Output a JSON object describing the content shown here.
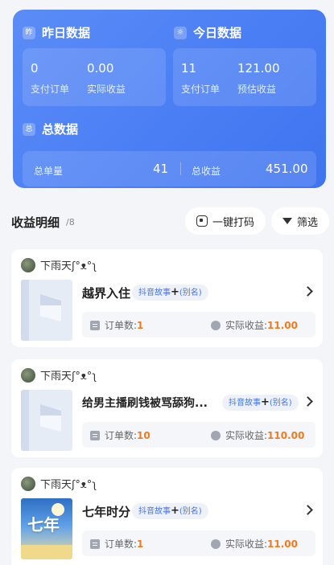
{
  "yesterday": {
    "icon_text": "昨",
    "title": "昨日数据",
    "paid_orders_value": "0",
    "paid_orders_label": "支付订单",
    "actual_income_value": "0.00",
    "actual_income_label": "实际收益"
  },
  "today": {
    "title": "今日数据",
    "paid_orders_value": "11",
    "paid_orders_label": "支付订单",
    "est_income_value": "121.00",
    "est_income_label": "预估收益"
  },
  "total": {
    "icon_text": "总",
    "title": "总数据",
    "orders_label": "总单量",
    "orders_value": "41",
    "income_label": "总收益",
    "income_value": "451.00"
  },
  "details": {
    "title": "收益明细",
    "count": "/8",
    "one_click_label": "一键打码",
    "filter_label": "筛选"
  },
  "orders": [
    {
      "user": "下雨天ʃ°ᴥ°ʅ",
      "title": "越界入住",
      "tag_main": "抖音故事",
      "tag_plus": "+",
      "tag_alias": "(别名)",
      "order_label": "订单数:",
      "order_count": "1",
      "income_label": "实际收益:",
      "income_value": "11.00"
    },
    {
      "user": "下雨天ʃ°ᴥ°ʅ",
      "title": "给男主播刷钱被骂舔狗...",
      "tag_main": "抖音故事",
      "tag_plus": "+",
      "tag_alias": "(别名)",
      "order_label": "订单数:",
      "order_count": "10",
      "income_label": "实际收益:",
      "income_value": "110.00"
    },
    {
      "user": "下雨天ʃ°ᴥ°ʅ",
      "title": "七年时分",
      "cover_text": "七年",
      "tag_main": "抖音故事",
      "tag_plus": "+",
      "tag_alias": "(别名)",
      "order_label": "订单数:",
      "order_count": "1",
      "income_label": "实际收益:",
      "income_value": "11.00"
    }
  ],
  "colors": {
    "accent": "#3f74f0",
    "highlight": "#f07a1e"
  }
}
